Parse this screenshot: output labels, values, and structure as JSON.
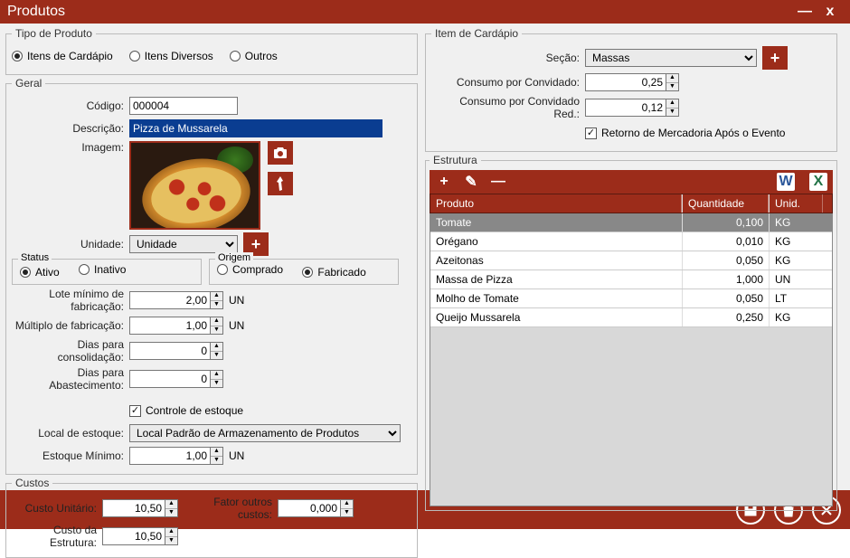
{
  "titlebar": {
    "title": "Produtos",
    "minimize": "—",
    "close": "x"
  },
  "tipo": {
    "legend": "Tipo de Produto",
    "opt_cardapio": "Itens de Cardápio",
    "opt_diversos": "Itens Diversos",
    "opt_outros": "Outros"
  },
  "geral": {
    "legend": "Geral",
    "codigo_label": "Código:",
    "codigo": "000004",
    "descricao_label": "Descrição:",
    "descricao": "Pizza de Mussarela",
    "imagem_label": "Imagem:",
    "unidade_label": "Unidade:",
    "unidade": "Unidade",
    "status_label": "Status",
    "status_ativo": "Ativo",
    "status_inativo": "Inativo",
    "origem_label": "Origem",
    "origem_comprado": "Comprado",
    "origem_fabricado": "Fabricado",
    "lote_label": "Lote mínimo de fabricação:",
    "lote": "2,00",
    "lote_un": "UN",
    "multiplo_label": "Múltiplo de fabricação:",
    "multiplo": "1,00",
    "multiplo_un": "UN",
    "diasconsol_label": "Dias para consolidação:",
    "diasconsol": "0",
    "diasabast_label": "Dias para Abastecimento:",
    "diasabast": "0",
    "controle_estoque": "Controle de estoque",
    "local_estoque_label": "Local de estoque:",
    "local_estoque": "Local Padrão de Armazenamento de Produtos",
    "estoque_min_label": "Estoque Mínimo:",
    "estoque_min": "1,00",
    "estoque_min_un": "UN"
  },
  "custos": {
    "legend": "Custos",
    "unitario_label": "Custo Unitário:",
    "unitario": "10,50",
    "estrutura_label": "Custo da Estrutura:",
    "estrutura": "10,50",
    "fator_label": "Fator outros custos:",
    "fator": "0,000"
  },
  "item": {
    "legend": "Item de Cardápio",
    "secao_label": "Seção:",
    "secao": "Massas",
    "consumo_label": "Consumo por Convidado:",
    "consumo": "0,25",
    "consumo_red_label": "Consumo por Convidado Red.:",
    "consumo_red": "0,12",
    "retorno": "Retorno de Mercadoria Após o Evento"
  },
  "estrutura": {
    "legend": "Estrutura",
    "col_produto": "Produto",
    "col_qtd": "Quantidade",
    "col_unid": "Unid.",
    "rows": [
      {
        "p": "Tomate",
        "q": "0,100",
        "u": "KG"
      },
      {
        "p": "Orégano",
        "q": "0,010",
        "u": "KG"
      },
      {
        "p": "Azeitonas",
        "q": "0,050",
        "u": "KG"
      },
      {
        "p": "Massa de Pizza",
        "q": "1,000",
        "u": "UN"
      },
      {
        "p": "Molho de Tomate",
        "q": "0,050",
        "u": "LT"
      },
      {
        "p": "Queijo Mussarela",
        "q": "0,250",
        "u": "KG"
      }
    ]
  },
  "icons": {
    "plus": "+",
    "pencil": "✎",
    "minus": "—",
    "word": "W",
    "excel": "X"
  }
}
